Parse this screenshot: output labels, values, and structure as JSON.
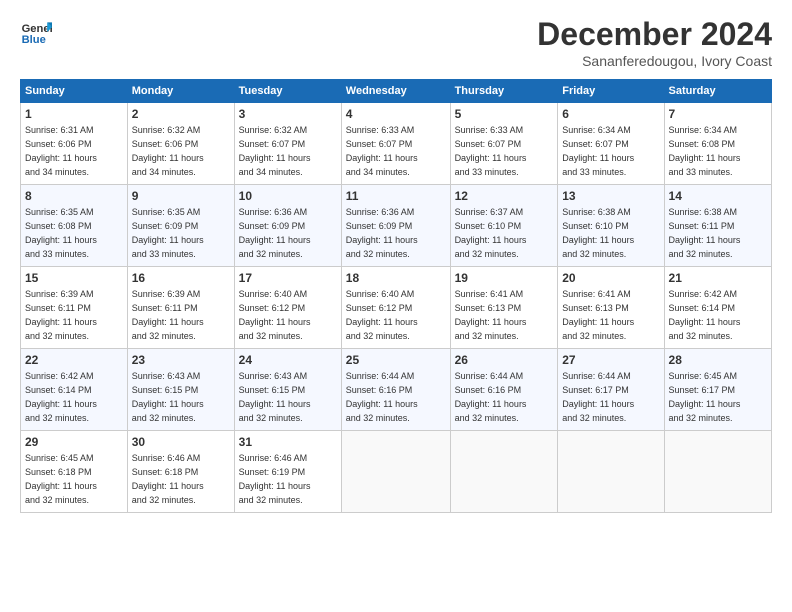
{
  "header": {
    "logo_line1": "General",
    "logo_line2": "Blue",
    "month_title": "December 2024",
    "subtitle": "Sananferedougou, Ivory Coast"
  },
  "weekdays": [
    "Sunday",
    "Monday",
    "Tuesday",
    "Wednesday",
    "Thursday",
    "Friday",
    "Saturday"
  ],
  "weeks": [
    [
      {
        "day": "1",
        "info": "Sunrise: 6:31 AM\nSunset: 6:06 PM\nDaylight: 11 hours\nand 34 minutes."
      },
      {
        "day": "2",
        "info": "Sunrise: 6:32 AM\nSunset: 6:06 PM\nDaylight: 11 hours\nand 34 minutes."
      },
      {
        "day": "3",
        "info": "Sunrise: 6:32 AM\nSunset: 6:07 PM\nDaylight: 11 hours\nand 34 minutes."
      },
      {
        "day": "4",
        "info": "Sunrise: 6:33 AM\nSunset: 6:07 PM\nDaylight: 11 hours\nand 34 minutes."
      },
      {
        "day": "5",
        "info": "Sunrise: 6:33 AM\nSunset: 6:07 PM\nDaylight: 11 hours\nand 33 minutes."
      },
      {
        "day": "6",
        "info": "Sunrise: 6:34 AM\nSunset: 6:07 PM\nDaylight: 11 hours\nand 33 minutes."
      },
      {
        "day": "7",
        "info": "Sunrise: 6:34 AM\nSunset: 6:08 PM\nDaylight: 11 hours\nand 33 minutes."
      }
    ],
    [
      {
        "day": "8",
        "info": "Sunrise: 6:35 AM\nSunset: 6:08 PM\nDaylight: 11 hours\nand 33 minutes."
      },
      {
        "day": "9",
        "info": "Sunrise: 6:35 AM\nSunset: 6:09 PM\nDaylight: 11 hours\nand 33 minutes."
      },
      {
        "day": "10",
        "info": "Sunrise: 6:36 AM\nSunset: 6:09 PM\nDaylight: 11 hours\nand 32 minutes."
      },
      {
        "day": "11",
        "info": "Sunrise: 6:36 AM\nSunset: 6:09 PM\nDaylight: 11 hours\nand 32 minutes."
      },
      {
        "day": "12",
        "info": "Sunrise: 6:37 AM\nSunset: 6:10 PM\nDaylight: 11 hours\nand 32 minutes."
      },
      {
        "day": "13",
        "info": "Sunrise: 6:38 AM\nSunset: 6:10 PM\nDaylight: 11 hours\nand 32 minutes."
      },
      {
        "day": "14",
        "info": "Sunrise: 6:38 AM\nSunset: 6:11 PM\nDaylight: 11 hours\nand 32 minutes."
      }
    ],
    [
      {
        "day": "15",
        "info": "Sunrise: 6:39 AM\nSunset: 6:11 PM\nDaylight: 11 hours\nand 32 minutes."
      },
      {
        "day": "16",
        "info": "Sunrise: 6:39 AM\nSunset: 6:11 PM\nDaylight: 11 hours\nand 32 minutes."
      },
      {
        "day": "17",
        "info": "Sunrise: 6:40 AM\nSunset: 6:12 PM\nDaylight: 11 hours\nand 32 minutes."
      },
      {
        "day": "18",
        "info": "Sunrise: 6:40 AM\nSunset: 6:12 PM\nDaylight: 11 hours\nand 32 minutes."
      },
      {
        "day": "19",
        "info": "Sunrise: 6:41 AM\nSunset: 6:13 PM\nDaylight: 11 hours\nand 32 minutes."
      },
      {
        "day": "20",
        "info": "Sunrise: 6:41 AM\nSunset: 6:13 PM\nDaylight: 11 hours\nand 32 minutes."
      },
      {
        "day": "21",
        "info": "Sunrise: 6:42 AM\nSunset: 6:14 PM\nDaylight: 11 hours\nand 32 minutes."
      }
    ],
    [
      {
        "day": "22",
        "info": "Sunrise: 6:42 AM\nSunset: 6:14 PM\nDaylight: 11 hours\nand 32 minutes."
      },
      {
        "day": "23",
        "info": "Sunrise: 6:43 AM\nSunset: 6:15 PM\nDaylight: 11 hours\nand 32 minutes."
      },
      {
        "day": "24",
        "info": "Sunrise: 6:43 AM\nSunset: 6:15 PM\nDaylight: 11 hours\nand 32 minutes."
      },
      {
        "day": "25",
        "info": "Sunrise: 6:44 AM\nSunset: 6:16 PM\nDaylight: 11 hours\nand 32 minutes."
      },
      {
        "day": "26",
        "info": "Sunrise: 6:44 AM\nSunset: 6:16 PM\nDaylight: 11 hours\nand 32 minutes."
      },
      {
        "day": "27",
        "info": "Sunrise: 6:44 AM\nSunset: 6:17 PM\nDaylight: 11 hours\nand 32 minutes."
      },
      {
        "day": "28",
        "info": "Sunrise: 6:45 AM\nSunset: 6:17 PM\nDaylight: 11 hours\nand 32 minutes."
      }
    ],
    [
      {
        "day": "29",
        "info": "Sunrise: 6:45 AM\nSunset: 6:18 PM\nDaylight: 11 hours\nand 32 minutes."
      },
      {
        "day": "30",
        "info": "Sunrise: 6:46 AM\nSunset: 6:18 PM\nDaylight: 11 hours\nand 32 minutes."
      },
      {
        "day": "31",
        "info": "Sunrise: 6:46 AM\nSunset: 6:19 PM\nDaylight: 11 hours\nand 32 minutes."
      },
      null,
      null,
      null,
      null
    ]
  ]
}
